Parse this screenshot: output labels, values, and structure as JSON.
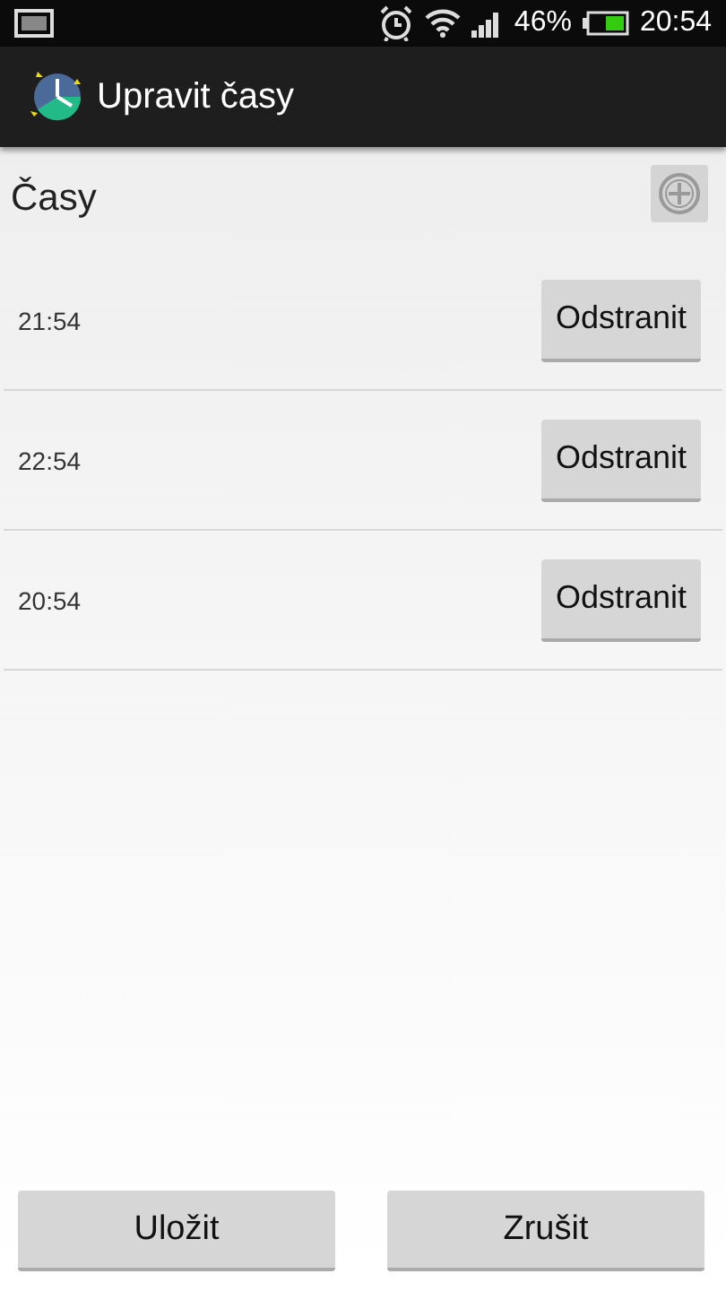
{
  "status_bar": {
    "battery": "46%",
    "time": "20:54"
  },
  "action_bar": {
    "title": "Upravit časy"
  },
  "section": {
    "title": "Časy"
  },
  "times": [
    {
      "time": "21:54",
      "button": "Odstranit"
    },
    {
      "time": "22:54",
      "button": "Odstranit"
    },
    {
      "time": "20:54",
      "button": "Odstranit"
    }
  ],
  "buttons": [
    "Uložit",
    "Zrušit"
  ]
}
